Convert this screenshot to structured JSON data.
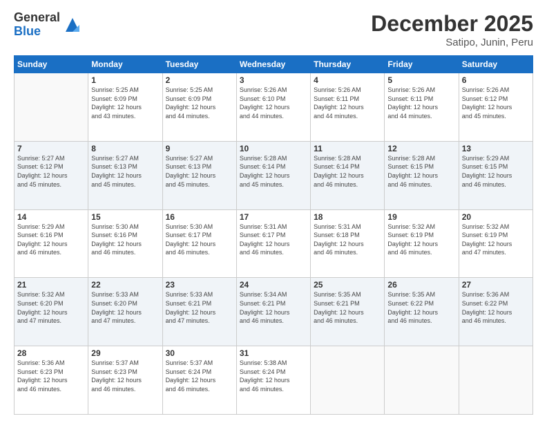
{
  "header": {
    "logo_general": "General",
    "logo_blue": "Blue",
    "title": "December 2025",
    "subtitle": "Satipo, Junin, Peru"
  },
  "days_of_week": [
    "Sunday",
    "Monday",
    "Tuesday",
    "Wednesday",
    "Thursday",
    "Friday",
    "Saturday"
  ],
  "weeks": [
    [
      {
        "num": "",
        "info": ""
      },
      {
        "num": "1",
        "info": "Sunrise: 5:25 AM\nSunset: 6:09 PM\nDaylight: 12 hours\nand 43 minutes."
      },
      {
        "num": "2",
        "info": "Sunrise: 5:25 AM\nSunset: 6:09 PM\nDaylight: 12 hours\nand 44 minutes."
      },
      {
        "num": "3",
        "info": "Sunrise: 5:26 AM\nSunset: 6:10 PM\nDaylight: 12 hours\nand 44 minutes."
      },
      {
        "num": "4",
        "info": "Sunrise: 5:26 AM\nSunset: 6:11 PM\nDaylight: 12 hours\nand 44 minutes."
      },
      {
        "num": "5",
        "info": "Sunrise: 5:26 AM\nSunset: 6:11 PM\nDaylight: 12 hours\nand 44 minutes."
      },
      {
        "num": "6",
        "info": "Sunrise: 5:26 AM\nSunset: 6:12 PM\nDaylight: 12 hours\nand 45 minutes."
      }
    ],
    [
      {
        "num": "7",
        "info": "Sunrise: 5:27 AM\nSunset: 6:12 PM\nDaylight: 12 hours\nand 45 minutes."
      },
      {
        "num": "8",
        "info": "Sunrise: 5:27 AM\nSunset: 6:13 PM\nDaylight: 12 hours\nand 45 minutes."
      },
      {
        "num": "9",
        "info": "Sunrise: 5:27 AM\nSunset: 6:13 PM\nDaylight: 12 hours\nand 45 minutes."
      },
      {
        "num": "10",
        "info": "Sunrise: 5:28 AM\nSunset: 6:14 PM\nDaylight: 12 hours\nand 45 minutes."
      },
      {
        "num": "11",
        "info": "Sunrise: 5:28 AM\nSunset: 6:14 PM\nDaylight: 12 hours\nand 46 minutes."
      },
      {
        "num": "12",
        "info": "Sunrise: 5:28 AM\nSunset: 6:15 PM\nDaylight: 12 hours\nand 46 minutes."
      },
      {
        "num": "13",
        "info": "Sunrise: 5:29 AM\nSunset: 6:15 PM\nDaylight: 12 hours\nand 46 minutes."
      }
    ],
    [
      {
        "num": "14",
        "info": "Sunrise: 5:29 AM\nSunset: 6:16 PM\nDaylight: 12 hours\nand 46 minutes."
      },
      {
        "num": "15",
        "info": "Sunrise: 5:30 AM\nSunset: 6:16 PM\nDaylight: 12 hours\nand 46 minutes."
      },
      {
        "num": "16",
        "info": "Sunrise: 5:30 AM\nSunset: 6:17 PM\nDaylight: 12 hours\nand 46 minutes."
      },
      {
        "num": "17",
        "info": "Sunrise: 5:31 AM\nSunset: 6:17 PM\nDaylight: 12 hours\nand 46 minutes."
      },
      {
        "num": "18",
        "info": "Sunrise: 5:31 AM\nSunset: 6:18 PM\nDaylight: 12 hours\nand 46 minutes."
      },
      {
        "num": "19",
        "info": "Sunrise: 5:32 AM\nSunset: 6:19 PM\nDaylight: 12 hours\nand 46 minutes."
      },
      {
        "num": "20",
        "info": "Sunrise: 5:32 AM\nSunset: 6:19 PM\nDaylight: 12 hours\nand 47 minutes."
      }
    ],
    [
      {
        "num": "21",
        "info": "Sunrise: 5:32 AM\nSunset: 6:20 PM\nDaylight: 12 hours\nand 47 minutes."
      },
      {
        "num": "22",
        "info": "Sunrise: 5:33 AM\nSunset: 6:20 PM\nDaylight: 12 hours\nand 47 minutes."
      },
      {
        "num": "23",
        "info": "Sunrise: 5:33 AM\nSunset: 6:21 PM\nDaylight: 12 hours\nand 47 minutes."
      },
      {
        "num": "24",
        "info": "Sunrise: 5:34 AM\nSunset: 6:21 PM\nDaylight: 12 hours\nand 46 minutes."
      },
      {
        "num": "25",
        "info": "Sunrise: 5:35 AM\nSunset: 6:21 PM\nDaylight: 12 hours\nand 46 minutes."
      },
      {
        "num": "26",
        "info": "Sunrise: 5:35 AM\nSunset: 6:22 PM\nDaylight: 12 hours\nand 46 minutes."
      },
      {
        "num": "27",
        "info": "Sunrise: 5:36 AM\nSunset: 6:22 PM\nDaylight: 12 hours\nand 46 minutes."
      }
    ],
    [
      {
        "num": "28",
        "info": "Sunrise: 5:36 AM\nSunset: 6:23 PM\nDaylight: 12 hours\nand 46 minutes."
      },
      {
        "num": "29",
        "info": "Sunrise: 5:37 AM\nSunset: 6:23 PM\nDaylight: 12 hours\nand 46 minutes."
      },
      {
        "num": "30",
        "info": "Sunrise: 5:37 AM\nSunset: 6:24 PM\nDaylight: 12 hours\nand 46 minutes."
      },
      {
        "num": "31",
        "info": "Sunrise: 5:38 AM\nSunset: 6:24 PM\nDaylight: 12 hours\nand 46 minutes."
      },
      {
        "num": "",
        "info": ""
      },
      {
        "num": "",
        "info": ""
      },
      {
        "num": "",
        "info": ""
      }
    ]
  ]
}
